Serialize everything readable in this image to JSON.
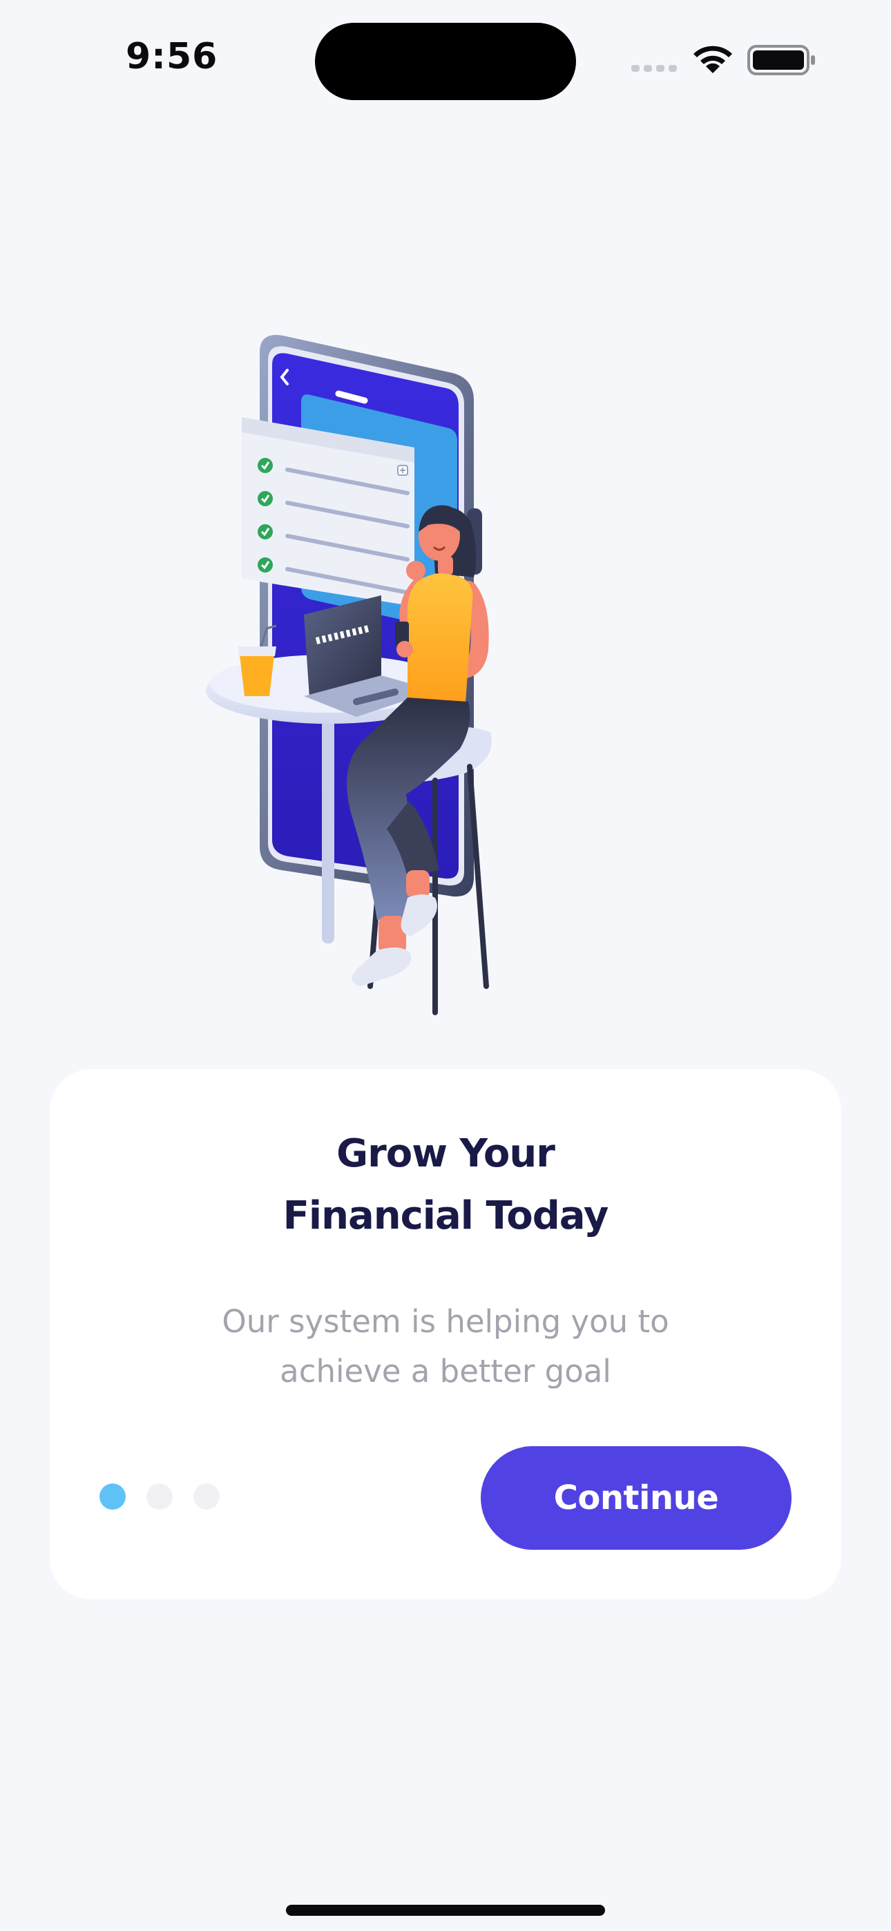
{
  "status_bar": {
    "time": "9:56",
    "icons": [
      "signal-icon",
      "wifi-icon",
      "battery-icon"
    ]
  },
  "illustration": {
    "icon": "onboarding-illustration",
    "description_icons": [
      "phone-icon",
      "checklist-icon",
      "woman-with-phone-icon",
      "laptop-icon",
      "juice-cup-icon",
      "table-icon",
      "stool-icon"
    ]
  },
  "card": {
    "title_line1": "Grow Your",
    "title_line2": "Financial Today",
    "subtitle_line1": "Our system is helping you to",
    "subtitle_line2": "achieve a better goal",
    "pagination": {
      "total": 3,
      "active_index": 0
    },
    "continue_label": "Continue"
  },
  "colors": {
    "background": "#f5f7fb",
    "accent": "#5143e3",
    "active_dot": "#5ec2f7",
    "title": "#1a1a48",
    "subtitle": "#a3a3ae"
  }
}
